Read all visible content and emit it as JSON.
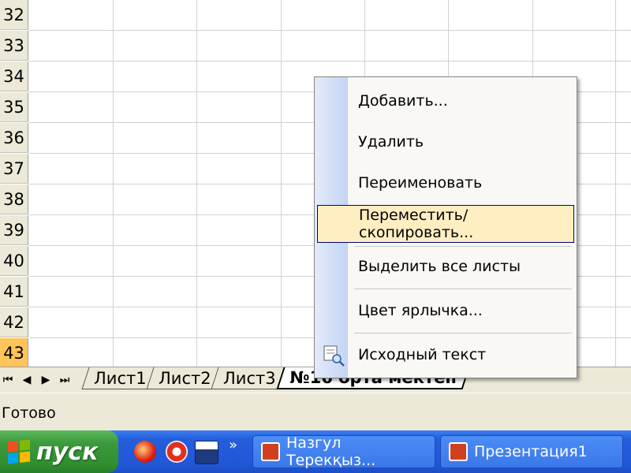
{
  "rows": [
    "32",
    "33",
    "34",
    "35",
    "36",
    "37",
    "38",
    "39",
    "40",
    "41",
    "42",
    "43"
  ],
  "selected_row": "43",
  "sheet_nav": [
    "first-sheet",
    "prev-sheet",
    "next-sheet",
    "last-sheet"
  ],
  "sheet_tabs": [
    {
      "label": "Лист1",
      "active": false
    },
    {
      "label": "Лист2",
      "active": false
    },
    {
      "label": "Лист3",
      "active": false
    },
    {
      "label": "№16 орта мектеп",
      "active": true
    }
  ],
  "status": {
    "text": "Готово"
  },
  "context_menu": {
    "items": [
      {
        "label": "Добавить...",
        "name": "menu-item-insert"
      },
      {
        "label": "Удалить",
        "name": "menu-item-delete"
      },
      {
        "label": "Переименовать",
        "name": "menu-item-rename"
      },
      {
        "label": "Переместить/скопировать...",
        "name": "menu-item-move-copy",
        "highlighted": true
      },
      {
        "label": "Выделить все листы",
        "name": "menu-item-select-all-sheets"
      },
      {
        "label": "Цвет ярлычка...",
        "name": "menu-item-tab-color"
      },
      {
        "label": "Исходный текст",
        "name": "menu-item-view-code",
        "icon": "view-code-icon"
      }
    ]
  },
  "taskbar": {
    "start_label": "пуск",
    "quicklaunch": [
      "opera-icon",
      "office-icon",
      "floppy-icon"
    ],
    "overflow": "»",
    "buttons": [
      {
        "label": "Назгул Терекқыз...",
        "icon": "powerpoint-icon"
      },
      {
        "label": "Презентация1",
        "icon": "powerpoint-icon"
      }
    ]
  },
  "colors": {
    "row_selected": "#ffc55a",
    "menu_highlight": "#ffeec2",
    "taskbar": "#245edb",
    "start": "#3c9a3c"
  }
}
